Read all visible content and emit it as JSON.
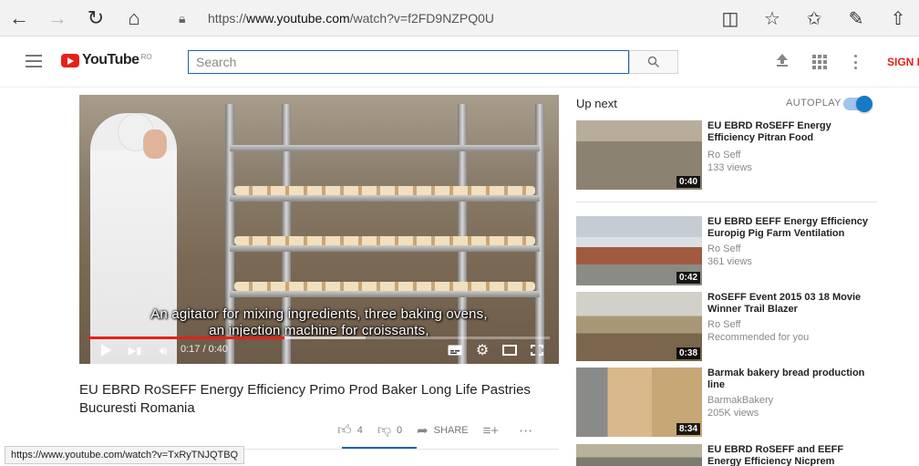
{
  "browser": {
    "url_prefix": "https://",
    "url_host": "www.youtube.com",
    "url_path": "/watch?v=f2FD9NZPQ0U",
    "status_url": "https://www.youtube.com/watch?v=TxRyTNJQTBQ"
  },
  "header": {
    "logo_text": "YouTube",
    "logo_country": "RO",
    "search_placeholder": "Search",
    "sign_in_label": "SIGN I"
  },
  "player": {
    "caption_line1": "An agitator for mixing ingredients, three baking ovens,",
    "caption_line2": "an injection machine for croissants,",
    "time_current": "0:17",
    "time_total": "0:40",
    "time_display": "0:17 / 0:40",
    "progress_fraction": 0.425,
    "buffer_fraction": 0.6
  },
  "video": {
    "title": "EU EBRD RoSEFF Energy Efficiency Primo Prod Baker Long Life Pastries Bucuresti Romania",
    "likes": "4",
    "dislikes": "0",
    "share_label": "SHARE"
  },
  "sidebar": {
    "up_next_label": "Up next",
    "autoplay_label": "AUTOPLAY",
    "autoplay_on": true,
    "items": [
      {
        "title": "EU EBRD RoSEFF Energy Efficiency Pitran Food",
        "channel": "Ro Seff",
        "views": "133 views",
        "duration": "0:40"
      },
      {
        "title": "EU EBRD EEFF Energy Efficiency Europig Pig Farm Ventilation",
        "channel": "Ro Seff",
        "views": "361 views",
        "duration": "0:42"
      },
      {
        "title": "RoSEFF Event 2015 03 18 Movie Winner Trail Blazer",
        "channel": "Ro Seff",
        "views": "Recommended for you",
        "duration": "0:38"
      },
      {
        "title": "Barmak bakery bread production line",
        "channel": "BarmakBakery",
        "views": "205K views",
        "duration": "8:34"
      },
      {
        "title": "EU EBRD RoSEFF and EEFF Energy Efficiency Nicprem",
        "channel": "",
        "views": "",
        "duration": ""
      }
    ]
  },
  "colors": {
    "brand_red": "#e62117",
    "link_blue": "#167ac6",
    "search_border": "#1c62b9"
  },
  "icons": [
    "back-arrow-icon",
    "forward-arrow-icon",
    "refresh-icon",
    "home-icon",
    "lock-icon",
    "reading-view-icon",
    "favorite-star-icon",
    "favorites-list-icon",
    "web-note-icon",
    "share-icon",
    "hamburger-menu-icon",
    "search-icon",
    "upload-icon",
    "apps-grid-icon",
    "more-vertical-icon",
    "play-icon",
    "next-icon",
    "volume-icon",
    "subtitles-icon",
    "settings-gear-icon",
    "theater-mode-icon",
    "fullscreen-icon",
    "thumbs-up-icon",
    "thumbs-down-icon",
    "share-arrow-icon",
    "add-to-playlist-icon",
    "more-horizontal-icon"
  ]
}
